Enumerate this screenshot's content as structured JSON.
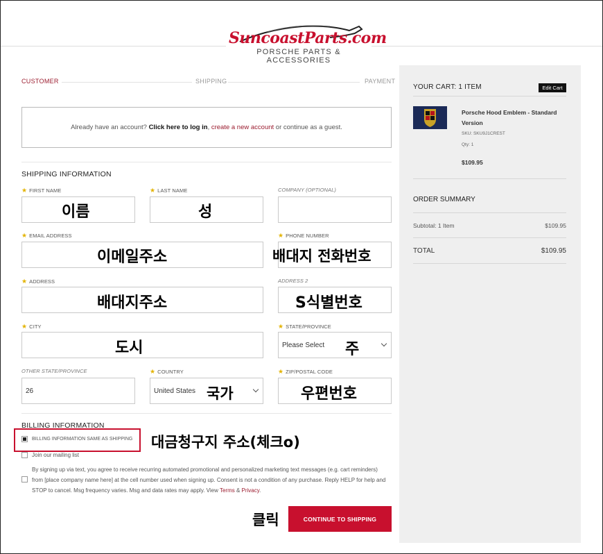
{
  "brand": {
    "logo_text": "SuncoastParts.com",
    "tagline": "PORSCHE PARTS & ACCESSORIES"
  },
  "steps": {
    "customer": "CUSTOMER",
    "shipping": "SHIPPING",
    "payment": "PAYMENT"
  },
  "login": {
    "prefix": "Already have an account? ",
    "login_link": "Click here to log in",
    "comma": ", ",
    "create_link": "create a new account",
    "suffix": " or continue as a guest."
  },
  "shipping": {
    "title": "SHIPPING INFORMATION",
    "first_name": {
      "label": "FIRST NAME",
      "value": ""
    },
    "last_name": {
      "label": "LAST NAME",
      "value": ""
    },
    "company": {
      "label": "COMPANY (OPTIONAL)",
      "value": ""
    },
    "email": {
      "label": "EMAIL ADDRESS",
      "value": ""
    },
    "phone": {
      "label": "PHONE NUMBER",
      "value": ""
    },
    "address": {
      "label": "ADDRESS",
      "value": ""
    },
    "address2": {
      "label": "ADDRESS 2",
      "value": ""
    },
    "city": {
      "label": "CITY",
      "value": ""
    },
    "state": {
      "label": "STATE/PROVINCE",
      "value": "Please Select"
    },
    "other_state": {
      "label": "OTHER STATE/PROVINCE",
      "value": "26"
    },
    "country": {
      "label": "COUNTRY",
      "value": "United States"
    },
    "zip": {
      "label": "ZIP/POSTAL CODE",
      "value": ""
    }
  },
  "billing": {
    "title": "BILLING INFORMATION",
    "same_as_shipping": "BILLING INFORMATION SAME AS SHIPPING",
    "same_checked": true,
    "mailing_list": "Join our mailing list",
    "consent_text": "By signing up via text, you agree to receive recurring automated promotional and personalized marketing text messages (e.g. cart reminders) from [place company name here] at the cell number used when signing up. Consent is not a condition of any purchase. Reply HELP for help and STOP to cancel. Msg frequency varies. Msg and data rates may apply. View ",
    "terms": "Terms",
    "amp": " & ",
    "privacy": "Privacy",
    "period": "."
  },
  "continue_label": "CONTINUE TO SHIPPING",
  "annotations": {
    "first_name": "이름",
    "last_name": "성",
    "email": "이메일주소",
    "phone": "배대지 전화번호",
    "address": "배대지주소",
    "address2": "S식별번호",
    "city": "도시",
    "state": "주",
    "country": "국가",
    "zip": "우편번호",
    "billing": "대금청구지 주소(체크o)",
    "click": "클릭"
  },
  "cart": {
    "title": "YOUR CART: 1 ITEM",
    "edit_label": "Edit Cart",
    "product_name": "Porsche Hood Emblem - Standard Version",
    "sku": "SKU: SKU9J1CREST",
    "qty": "Qty: 1",
    "price": "$109.95",
    "order_summary": "ORDER SUMMARY",
    "subtotal_label": "Subtotal: 1 Item",
    "subtotal_value": "$109.95",
    "total_label": "TOTAL",
    "total_value": "$109.95"
  },
  "colors": {
    "accent": "#c8102e",
    "sidebar_bg": "#efefef"
  }
}
